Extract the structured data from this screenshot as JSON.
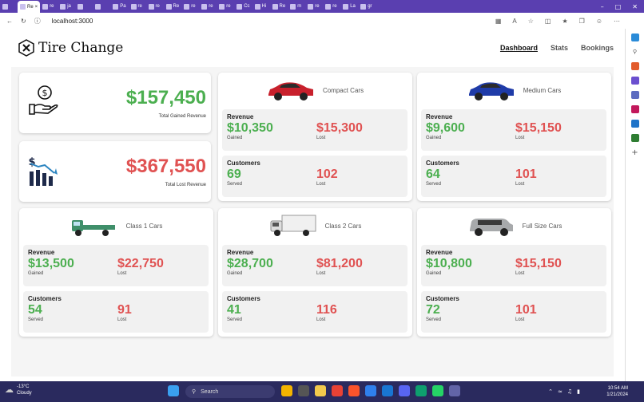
{
  "browser": {
    "tabs": [
      {
        "label": "",
        "active": false
      },
      {
        "label": "Re",
        "active": true
      },
      {
        "label": "re",
        "active": false
      },
      {
        "label": "ja",
        "active": false
      },
      {
        "label": "",
        "active": false
      },
      {
        "label": "",
        "active": false
      },
      {
        "label": "Pa",
        "active": false
      },
      {
        "label": "re",
        "active": false
      },
      {
        "label": "re",
        "active": false
      },
      {
        "label": "Re",
        "active": false
      },
      {
        "label": "re",
        "active": false
      },
      {
        "label": "re",
        "active": false
      },
      {
        "label": "re",
        "active": false
      },
      {
        "label": "Cc",
        "active": false
      },
      {
        "label": "Hi",
        "active": false
      },
      {
        "label": "Re",
        "active": false
      },
      {
        "label": "m",
        "active": false
      },
      {
        "label": "re",
        "active": false
      },
      {
        "label": "re",
        "active": false
      },
      {
        "label": "La",
        "active": false
      },
      {
        "label": "gr",
        "active": false
      }
    ],
    "url": "localhost:3000"
  },
  "header": {
    "logo_text": "Tire Change",
    "nav": [
      "Dashboard",
      "Stats",
      "Bookings"
    ]
  },
  "summary": {
    "gained": {
      "amount": "$157,450",
      "label": "Total Gained Revenue"
    },
    "lost": {
      "amount": "$367,550",
      "label": "Total Lost Revenue"
    }
  },
  "labels": {
    "revenue": "Revenue",
    "customers": "Customers",
    "gained": "Gained",
    "lost": "Lost",
    "served": "Served"
  },
  "cars": [
    {
      "title": "Compact Cars",
      "rev_gained": "$10,350",
      "rev_lost": "$15,300",
      "cust_served": "69",
      "cust_lost": "102",
      "color": "#c8202c"
    },
    {
      "title": "Medium Cars",
      "rev_gained": "$9,600",
      "rev_lost": "$15,150",
      "cust_served": "64",
      "cust_lost": "101",
      "color": "#1f3ba8"
    },
    {
      "title": "Class 1 Cars",
      "rev_gained": "$13,500",
      "rev_lost": "$22,750",
      "cust_served": "54",
      "cust_lost": "91",
      "color": "#3f8f6a"
    },
    {
      "title": "Class 2 Cars",
      "rev_gained": "$28,700",
      "rev_lost": "$81,200",
      "cust_served": "41",
      "cust_lost": "116",
      "color": "#e8e8e8"
    },
    {
      "title": "Full Size Cars",
      "rev_gained": "$10,800",
      "rev_lost": "$15,150",
      "cust_served": "72",
      "cust_lost": "101",
      "color": "#a7a9ab"
    }
  ],
  "taskbar": {
    "temp": "-13°C",
    "weather": "Cloudy",
    "search_placeholder": "Search",
    "time": "10:54 AM",
    "date": "1/21/2024"
  },
  "colors": {
    "green": "#4caf50",
    "red": "#e05252",
    "accent": "#5a3fb0"
  }
}
